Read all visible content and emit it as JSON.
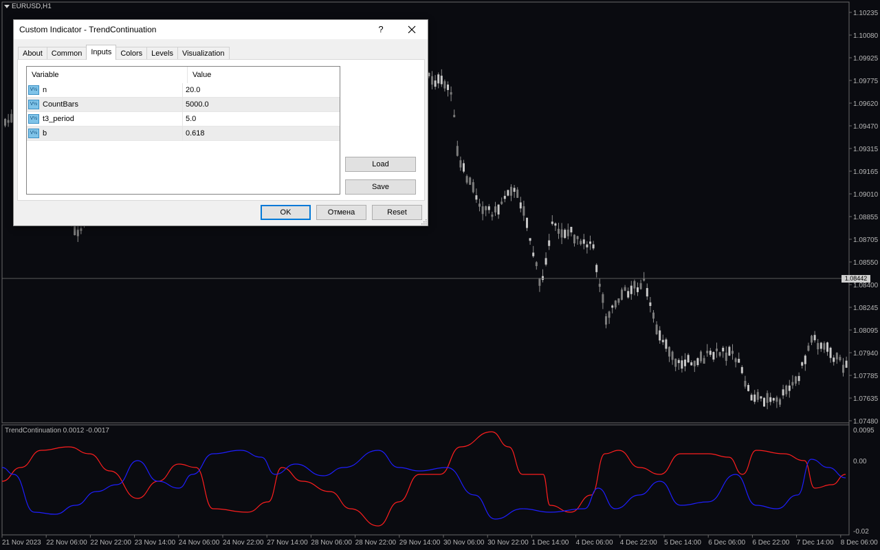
{
  "chart": {
    "symbol": "EURUSD,H1",
    "indicator_label": "TrendContinuation 0.0012 -0.0017",
    "current_price": "1.08442",
    "price_ticks": [
      "1.10235",
      "1.10080",
      "1.09925",
      "1.09775",
      "1.09620",
      "1.09470",
      "1.09315",
      "1.09165",
      "1.09010",
      "1.08855",
      "1.08705",
      "1.08550",
      "1.08400",
      "1.08245",
      "1.08095",
      "1.07940",
      "1.07785",
      "1.07635",
      "1.07480"
    ],
    "indicator_ticks": [
      "0.0095",
      "0.00",
      "-0.02"
    ],
    "time_ticks": [
      "21 Nov 2023",
      "22 Nov 06:00",
      "22 Nov 22:00",
      "23 Nov 14:00",
      "24 Nov 06:00",
      "24 Nov 22:00",
      "27 Nov 14:00",
      "28 Nov 06:00",
      "28 Nov 22:00",
      "29 Nov 14:00",
      "30 Nov 06:00",
      "30 Nov 22:00",
      "1 Dec 14:00",
      "4 Dec 06:00",
      "4 Dec 22:00",
      "5 Dec 14:00",
      "6 Dec 06:00",
      "6 Dec 22:00",
      "7 Dec 14:00",
      "8 Dec 06:00"
    ],
    "colors": {
      "background": "#0a0b10",
      "candles": "#b5b5b5",
      "line_red": "#ff1e1e",
      "line_blue": "#1e1eff"
    }
  },
  "dialog": {
    "title": "Custom Indicator - TrendContinuation",
    "help": "?",
    "tabs": [
      "About",
      "Common",
      "Inputs",
      "Colors",
      "Levels",
      "Visualization"
    ],
    "active_tab": "Inputs",
    "columns": [
      "Variable",
      "Value"
    ],
    "param_icon": "V½",
    "params": [
      {
        "name": "n",
        "value": "20.0"
      },
      {
        "name": "CountBars",
        "value": "5000.0"
      },
      {
        "name": "t3_period",
        "value": "5.0"
      },
      {
        "name": "b",
        "value": "0.618"
      }
    ],
    "load_label": "Load",
    "save_label": "Save",
    "ok_label": "OK",
    "cancel_label": "Отмена",
    "reset_label": "Reset"
  }
}
